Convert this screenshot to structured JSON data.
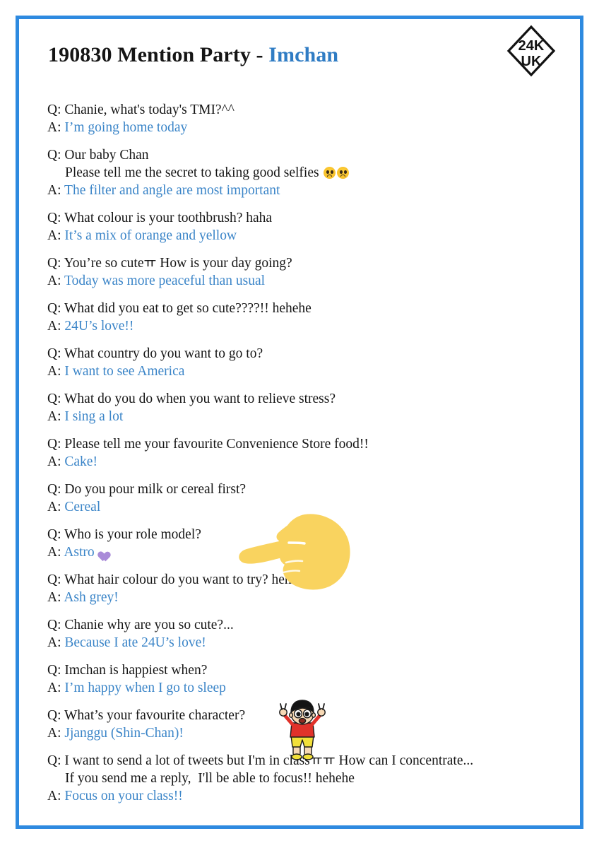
{
  "document": {
    "title_main": "190830 Mention Party - ",
    "title_accent": "Imchan",
    "border_color": "#2e8ae0",
    "answer_color": "#3b85c8",
    "question_color": "#161616",
    "heart_color": "#a98bd8",
    "hand_color": "#f9d35f"
  },
  "logo": {
    "line1": "24K",
    "line2": "UK",
    "shape": "diamond-outline",
    "name": "24k-uk-logo"
  },
  "labels": {
    "question_tag": "Q: ",
    "answer_tag": "A: "
  },
  "qa": [
    {
      "question": "Chanie, what's today's TMI?^^",
      "question_cont": null,
      "question_emoji": null,
      "answer": "I’m going home today",
      "answer_emoji": null
    },
    {
      "question": "Our baby Chan",
      "question_cont": "Please tell me the secret to taking good selfies ",
      "question_emoji": "worried-face,worried-face",
      "answer": "The filter and angle are most important",
      "answer_emoji": null
    },
    {
      "question": "What colour is your toothbrush? haha",
      "question_cont": null,
      "question_emoji": null,
      "answer": "It’s a mix of orange and yellow",
      "answer_emoji": null
    },
    {
      "question": "You’re so cuteㅠ How is your day going?",
      "question_cont": null,
      "question_emoji": null,
      "answer": "Today was more peaceful than usual",
      "answer_emoji": null
    },
    {
      "question": "What did you eat to get so cute????!! hehehe",
      "question_cont": null,
      "question_emoji": null,
      "answer": "24U’s love!!",
      "answer_emoji": null
    },
    {
      "question": "What country do you want to go to?",
      "question_cont": null,
      "question_emoji": null,
      "answer": "I want to see America",
      "answer_emoji": null
    },
    {
      "question": "What do you do when you want to relieve stress?",
      "question_cont": null,
      "question_emoji": null,
      "answer": "I sing a lot",
      "answer_emoji": null
    },
    {
      "question": "Please tell me your favourite Convenience Store food!!",
      "question_cont": null,
      "question_emoji": null,
      "answer": "Cake!",
      "answer_emoji": null
    },
    {
      "question": "Do you pour milk or cereal first?",
      "question_cont": null,
      "question_emoji": null,
      "answer": "Cereal",
      "answer_emoji": null
    },
    {
      "question": "Who is your role model?",
      "question_cont": null,
      "question_emoji": null,
      "answer": "Astro",
      "answer_emoji": "purple-heart"
    },
    {
      "question": "What hair colour do you want to try? hehe",
      "question_cont": null,
      "question_emoji": null,
      "answer": "Ash grey!",
      "answer_emoji": null
    },
    {
      "question": "Chanie why are you so cute?...",
      "question_cont": null,
      "question_emoji": null,
      "answer": "Because I ate 24U’s love!",
      "answer_emoji": null
    },
    {
      "question": "Imchan is happiest when?",
      "question_cont": null,
      "question_emoji": null,
      "answer": "I’m happy when I go to sleep",
      "answer_emoji": null
    },
    {
      "question": "What’s your favourite character?",
      "question_cont": null,
      "question_emoji": null,
      "answer": "Jjanggu (Shin-Chan)!",
      "answer_emoji": null
    },
    {
      "question": "I want to send a lot of tweets but I'm in classㅠㅠ How can I concentrate...",
      "question_cont": "If you send me a reply,  I'll be able to focus!! hehehe",
      "question_emoji": null,
      "answer": "Focus on your class!!",
      "answer_emoji": null
    }
  ],
  "stickers": [
    {
      "name": "pointing-hand-left",
      "color": "#f9d35f"
    },
    {
      "name": "shin-chan-character",
      "shirt_color": "#e0322a",
      "shorts_color": "#f2e03a",
      "hair_color": "#111111",
      "skin_color": "#f7d9b5"
    }
  ]
}
